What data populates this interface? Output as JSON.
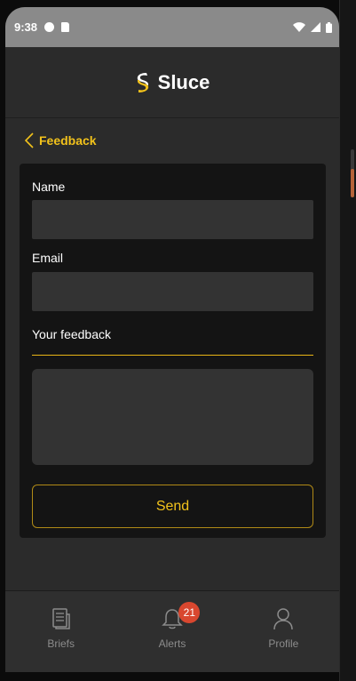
{
  "status": {
    "time": "9:38"
  },
  "app": {
    "name": "Sluce"
  },
  "nav": {
    "back_label": "Feedback"
  },
  "form": {
    "name_label": "Name",
    "name_value": "",
    "email_label": "Email",
    "email_value": "",
    "feedback_label": "Your feedback",
    "feedback_value": "",
    "send_label": "Send"
  },
  "tabs": [
    {
      "label": "Briefs",
      "icon": "briefs-icon"
    },
    {
      "label": "Alerts",
      "icon": "bell-icon",
      "badge": "21"
    },
    {
      "label": "Profile",
      "icon": "profile-icon"
    }
  ],
  "colors": {
    "accent": "#f2c21b",
    "badge": "#d9472f"
  }
}
